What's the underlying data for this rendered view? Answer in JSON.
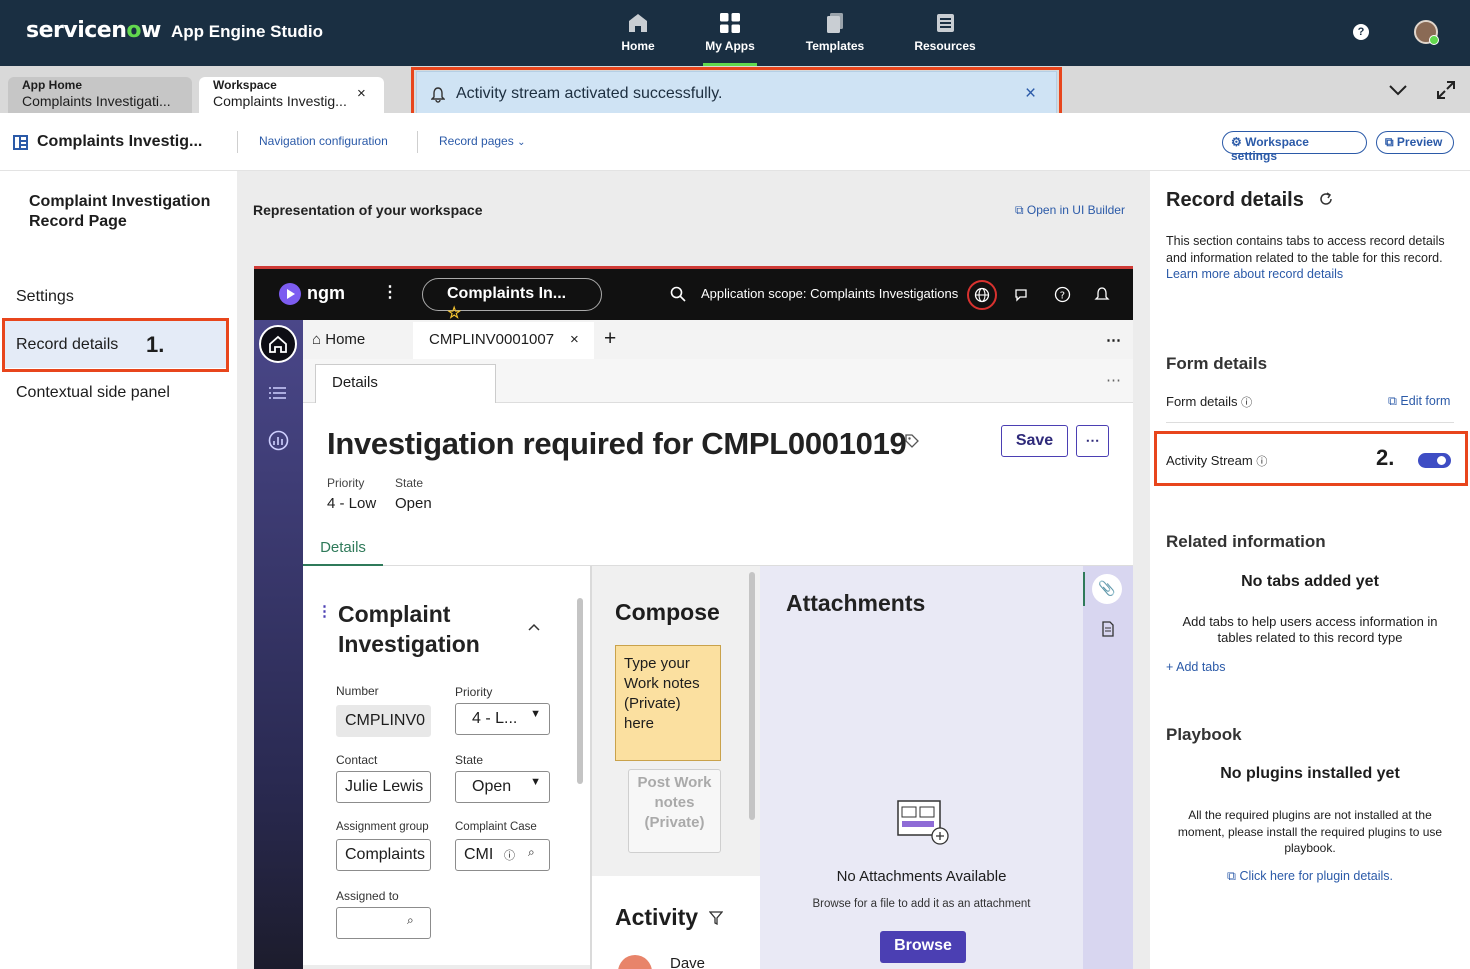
{
  "topbar": {
    "brand_pre": "servicen",
    "brand_o": "o",
    "brand_post": "w",
    "app_name": "App Engine Studio",
    "nav": [
      {
        "label": "Home",
        "icon": "home-icon"
      },
      {
        "label": "My Apps",
        "icon": "apps-grid-icon"
      },
      {
        "label": "Templates",
        "icon": "templates-icon"
      },
      {
        "label": "Resources",
        "icon": "resources-icon"
      }
    ],
    "help": "?"
  },
  "tabs": [
    {
      "title": "App Home",
      "sub": "Complaints Investigati..."
    },
    {
      "title": "Workspace",
      "sub": "Complaints Investig..."
    }
  ],
  "toast": {
    "message": "Activity stream activated successfully."
  },
  "appbar": {
    "title": "Complaints Investig...",
    "nav_config": "Navigation configuration",
    "record_pages": "Record pages",
    "workspace_settings": "Workspace settings",
    "preview": "Preview"
  },
  "left": {
    "heading": "Complaint Investigation Record Page",
    "items": [
      "Settings",
      "Record details",
      "Contextual side panel"
    ],
    "step": "1."
  },
  "center": {
    "heading": "Representation of your workspace",
    "open_builder": "Open in UI Builder"
  },
  "mock": {
    "logo": "ngm",
    "app_pill": "Complaints In...",
    "scope": "Application scope: Complaints Investigations",
    "tabs": {
      "home": "Home",
      "record": "CMPLINV0001007"
    },
    "details_tab": "Details",
    "record_title": "Investigation required for CMPL0001019",
    "save": "Save",
    "priority_label": "Priority",
    "priority_value": "4 - Low",
    "state_label": "State",
    "state_value": "Open",
    "subtab": "Details",
    "form_title_1": "Complaint",
    "form_title_2": "Investigation",
    "fields": {
      "number_label": "Number",
      "number_value": "CMPLINV0",
      "priority_label": "Priority",
      "priority_value": "4 - L...",
      "contact_label": "Contact",
      "contact_value": "Julie Lewis",
      "state_label": "State",
      "state_value": "Open",
      "group_label": "Assignment group",
      "group_value": "Complaints",
      "case_label": "Complaint Case",
      "case_value": "CMI",
      "assigned_label": "Assigned to"
    },
    "compose": {
      "title": "Compose",
      "placeholder": "Type your Work notes (Private) here",
      "post": "Post Work notes (Private)",
      "activity": "Activity",
      "author": "Dave"
    },
    "attachments": {
      "title": "Attachments",
      "empty": "No Attachments Available",
      "hint": "Browse for a file to add it as an attachment",
      "browse": "Browse"
    }
  },
  "right": {
    "title": "Record details",
    "desc": "This section contains tabs to access record details and information related to the table for this record.",
    "learn_more": "Learn more about record details",
    "form_heading": "Form details",
    "form_label": "Form details",
    "edit_form": "Edit form",
    "activity_label": "Activity Stream",
    "step": "2.",
    "activity_on": true,
    "related_heading": "Related information",
    "no_tabs": "No tabs added yet",
    "no_tabs_desc": "Add tabs to help users access information in tables related to this record type",
    "add_tabs": "Add tabs",
    "playbook_heading": "Playbook",
    "no_plugins": "No plugins installed yet",
    "no_plugins_desc": "All the required plugins are not installed at the moment, please install the required plugins to use playbook.",
    "plugin_link": "Click here for plugin details."
  },
  "colors": {
    "topbar": "#1a2f42",
    "accent_green": "#62d84e",
    "highlight": "#e8451c",
    "link": "#2b5aa8",
    "toggle": "#3e4dc4",
    "browse": "#4b3fb3"
  }
}
